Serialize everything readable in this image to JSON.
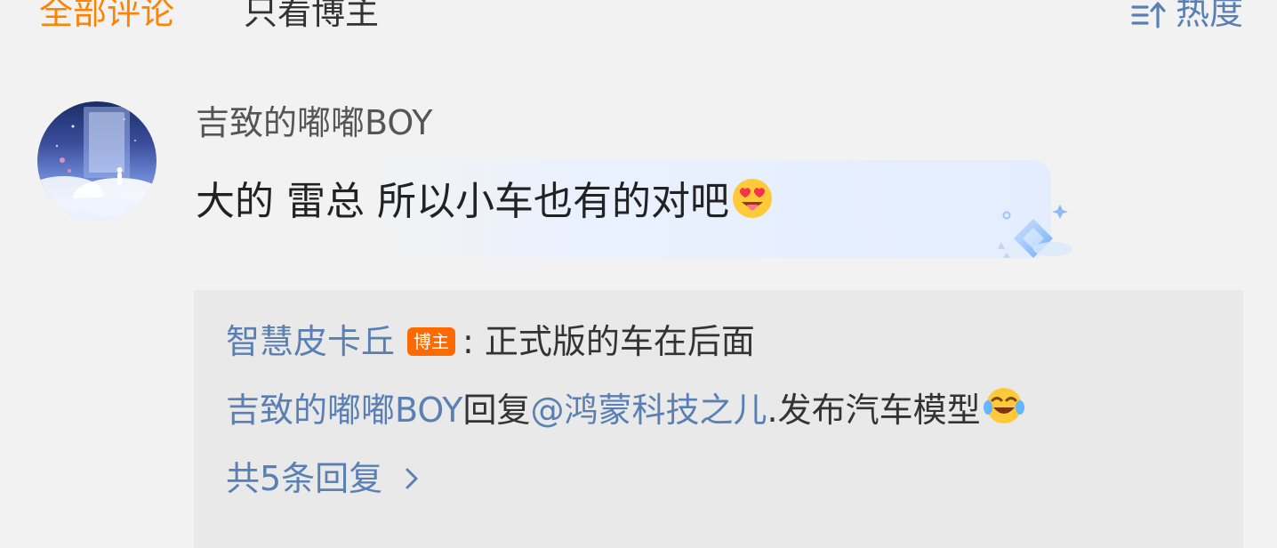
{
  "tabs": {
    "all_comments": "全部评论",
    "owner_only": "只看博主",
    "sort_label": "热度"
  },
  "comment": {
    "username": "吉致的嘟嘟BOY",
    "text": "大的 雷总 所以小车也有的对吧",
    "emoji": "heart-eyes-tongue-emoji",
    "replies": {
      "reply1": {
        "author": "智慧皮卡丘",
        "badge": "博主",
        "separator": ":",
        "text": "正式版的车在后面"
      },
      "reply2": {
        "author": "吉致的嘟嘟BOY",
        "action": "回复",
        "mention": "@鸿蒙科技之儿",
        "text": ".发布汽车模型",
        "emoji": "laughing-crying-emoji"
      },
      "more_label": "共5条回复"
    }
  },
  "colors": {
    "accent": "#ff8200",
    "link": "#5a7fb3",
    "badge": "#ff6a00",
    "background": "#f2f2f2",
    "reply_background": "#e9e9e9"
  }
}
